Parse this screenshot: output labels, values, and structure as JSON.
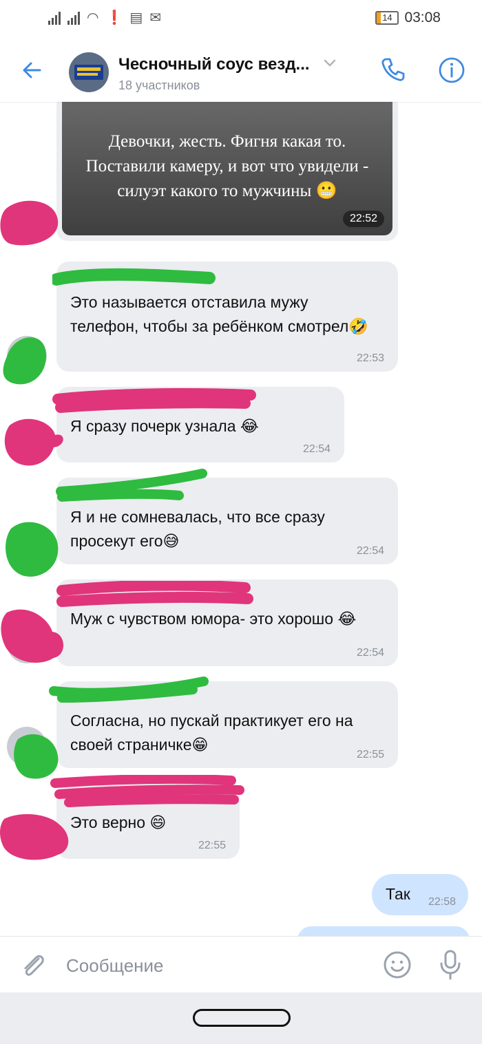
{
  "status_bar": {
    "time": "03:08",
    "battery": "14",
    "icons": [
      "signal-icon",
      "signal-icon",
      "wifi-icon",
      "alert-icon",
      "news-icon",
      "mail-icon"
    ]
  },
  "header": {
    "title": "Чесночный соус везд...",
    "subtitle": "18 участников",
    "icons": [
      "back-arrow-icon",
      "chevron-down-icon",
      "phone-icon",
      "info-icon"
    ],
    "accent_color": "#3f8ae0"
  },
  "messages": [
    {
      "type": "image",
      "text": "Девочки, жесть. Фигня какая то. Поставили камеру, и вот что увидели - силуэт какого то мужчины 😬",
      "time": "22:52"
    },
    {
      "type": "text",
      "direction": "in",
      "text": "Это называется отставила мужу телефон, чтобы за ребёнком смотрел🤣",
      "time": "22:53"
    },
    {
      "type": "text",
      "direction": "in",
      "text": "Я сразу почерк узнала 😂",
      "time": "22:54"
    },
    {
      "type": "text",
      "direction": "in",
      "text": "Я и не сомневалась, что все сразу просекут его😅",
      "time": "22:54"
    },
    {
      "type": "text",
      "direction": "in",
      "text": "Муж с чувством юмора- это хорошо 😂",
      "time": "22:54"
    },
    {
      "type": "text",
      "direction": "in",
      "text": "Согласна, но пускай практикует его на своей страничке😁",
      "time": "22:55"
    },
    {
      "type": "text",
      "direction": "in",
      "text": "Это верно 😄",
      "time": "22:55"
    },
    {
      "type": "text",
      "direction": "out",
      "text": "Так",
      "time": "22:58"
    }
  ],
  "input": {
    "placeholder": "Сообщение",
    "icons": [
      "paperclip-icon",
      "emoji-icon",
      "microphone-icon"
    ]
  },
  "colors": {
    "bubble_in": "#ebedf0",
    "bubble_out": "#cfe4ff",
    "scribble_pink": "#e0357a",
    "scribble_green": "#2fbb3f"
  }
}
